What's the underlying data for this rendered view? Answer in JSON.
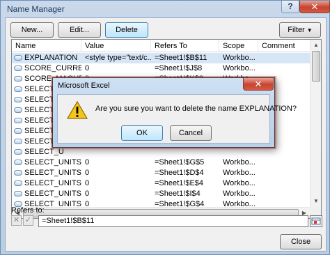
{
  "window": {
    "title": "Name Manager",
    "help": "?",
    "close": "✕"
  },
  "toolbar": {
    "new": "New...",
    "edit": "Edit...",
    "delete": "Delete",
    "filter": "Filter"
  },
  "columns": [
    "Name",
    "Value",
    "Refers To",
    "Scope",
    "Comment"
  ],
  "rows": [
    {
      "name": "EXPLANATION",
      "value": "<style type=\"text/c...",
      "refers": "=Sheet1!$B$11",
      "scope": "Workbo..."
    },
    {
      "name": "SCORE_CURRENT",
      "value": "0",
      "refers": "=Sheet1!$J$8",
      "scope": "Workbo..."
    },
    {
      "name": "SCORE_MAQUE",
      "value": "0",
      "refers": "=Sheet1!$K$8",
      "scope": "Workbo..."
    },
    {
      "name": "SELECT_U",
      "value": "",
      "refers": "",
      "scope": ""
    },
    {
      "name": "SELECT_U",
      "value": "",
      "refers": "",
      "scope": ""
    },
    {
      "name": "SELECT_U",
      "value": "",
      "refers": "",
      "scope": ""
    },
    {
      "name": "SELECT_U",
      "value": "",
      "refers": "",
      "scope": ""
    },
    {
      "name": "SELECT_U",
      "value": "",
      "refers": "",
      "scope": ""
    },
    {
      "name": "SELECT_U",
      "value": "",
      "refers": "",
      "scope": ""
    },
    {
      "name": "SELECT_U",
      "value": "",
      "refers": "",
      "scope": ""
    },
    {
      "name": "SELECT_UNITS_...",
      "value": "0",
      "refers": "=Sheet1!$G$5",
      "scope": "Workbo..."
    },
    {
      "name": "SELECT_UNITS_...",
      "value": "0",
      "refers": "=Sheet1!$D$4",
      "scope": "Workbo..."
    },
    {
      "name": "SELECT_UNITS_...",
      "value": "0",
      "refers": "=Sheet1!$E$4",
      "scope": "Workbo..."
    },
    {
      "name": "SELECT_UNITS_...",
      "value": "0",
      "refers": "=Sheet1!$I$4",
      "scope": "Workbo..."
    },
    {
      "name": "SELECT_UNITS_...",
      "value": "0",
      "refers": "=Sheet1!$G$4",
      "scope": "Workbo..."
    }
  ],
  "refers_to": {
    "label": "Refers to:",
    "value": "=Sheet1!$B$11"
  },
  "close_button": "Close",
  "dialog": {
    "title": "Microsoft Excel",
    "message": "Are you sure you want to delete the name EXPLANATION?",
    "ok": "OK",
    "cancel": "Cancel",
    "icon": "warning-icon"
  }
}
